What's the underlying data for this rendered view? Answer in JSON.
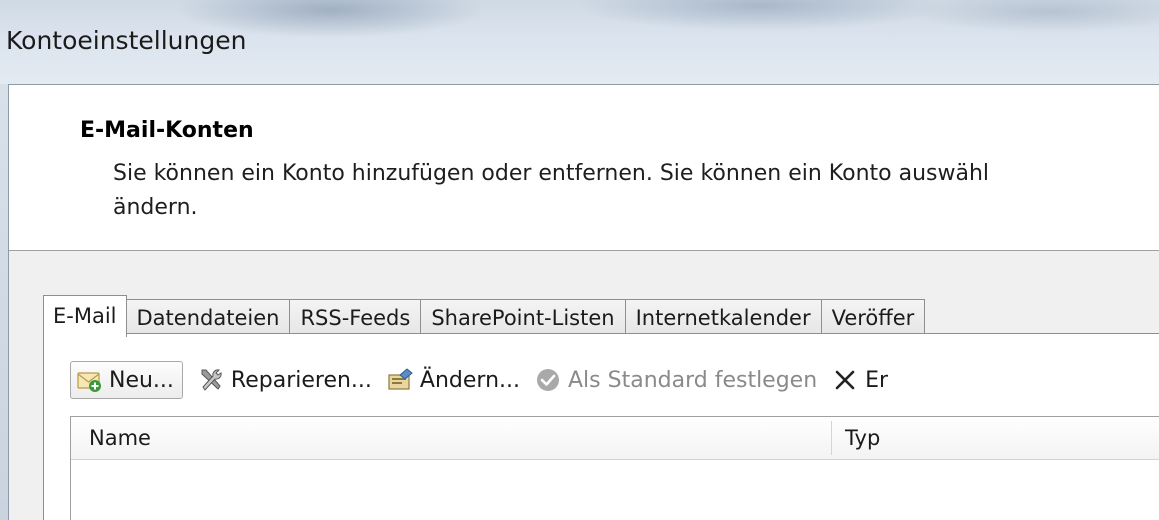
{
  "window": {
    "title": "Kontoeinstellungen"
  },
  "header": {
    "title": "E-Mail-Konten",
    "description_line1": "Sie können ein Konto hinzufügen oder entfernen. Sie können ein Konto auswähl",
    "description_line2": "ändern."
  },
  "tabs": [
    {
      "label": "E-Mail",
      "active": true
    },
    {
      "label": "Datendateien",
      "active": false
    },
    {
      "label": "RSS-Feeds",
      "active": false
    },
    {
      "label": "SharePoint-Listen",
      "active": false
    },
    {
      "label": "Internetkalender",
      "active": false
    },
    {
      "label": "Veröffer",
      "active": false
    }
  ],
  "toolbar": {
    "new_label": "Neu...",
    "repair_label": "Reparieren...",
    "change_label": "Ändern...",
    "set_default_label": "Als Standard festlegen",
    "remove_label": "Er",
    "icons": {
      "new": "new-mail-icon",
      "repair": "tools-icon",
      "change": "change-account-icon",
      "set_default": "checkmark-circle-icon",
      "remove": "x-icon"
    }
  },
  "list": {
    "columns": [
      "Name",
      "Typ"
    ]
  },
  "colors": {
    "panel_bg": "#f0f0f0",
    "border": "#8f8f8f",
    "disabled_text": "#8a8a8a"
  }
}
